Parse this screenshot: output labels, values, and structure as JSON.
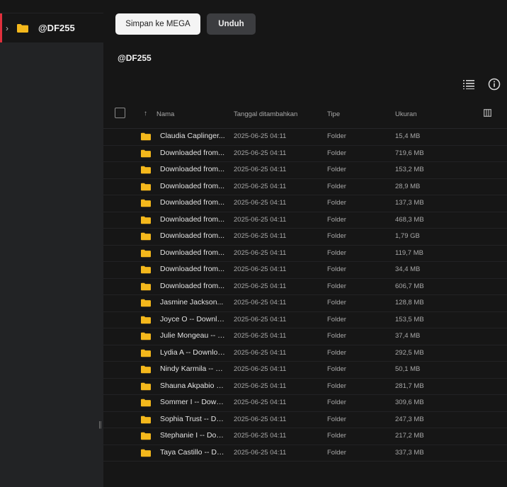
{
  "sidebar": {
    "items": [
      {
        "label": "@DF255"
      }
    ]
  },
  "toolbar": {
    "save_label": "Simpan ke MEGA",
    "download_label": "Unduh"
  },
  "path": {
    "title": "@DF255"
  },
  "colors": {
    "accent": "#e0303c",
    "folder": "#f4b81c"
  },
  "table": {
    "columns": {
      "name": "Nama",
      "date": "Tanggal ditambahkan",
      "type": "Tipe",
      "size": "Ukuran"
    },
    "rows": [
      {
        "name": "Claudia Caplinger...",
        "date": "2025-06-25 04:11",
        "type": "Folder",
        "size": "15,4 MB"
      },
      {
        "name": "Downloaded from...",
        "date": "2025-06-25 04:11",
        "type": "Folder",
        "size": "719,6 MB"
      },
      {
        "name": "Downloaded from...",
        "date": "2025-06-25 04:11",
        "type": "Folder",
        "size": "153,2 MB"
      },
      {
        "name": "Downloaded from...",
        "date": "2025-06-25 04:11",
        "type": "Folder",
        "size": "28,9 MB"
      },
      {
        "name": "Downloaded from...",
        "date": "2025-06-25 04:11",
        "type": "Folder",
        "size": "137,3 MB"
      },
      {
        "name": "Downloaded from...",
        "date": "2025-06-25 04:11",
        "type": "Folder",
        "size": "468,3 MB"
      },
      {
        "name": "Downloaded from...",
        "date": "2025-06-25 04:11",
        "type": "Folder",
        "size": "1,79 GB"
      },
      {
        "name": "Downloaded from...",
        "date": "2025-06-25 04:11",
        "type": "Folder",
        "size": "119,7 MB"
      },
      {
        "name": "Downloaded from...",
        "date": "2025-06-25 04:11",
        "type": "Folder",
        "size": "34,4 MB"
      },
      {
        "name": "Downloaded from...",
        "date": "2025-06-25 04:11",
        "type": "Folder",
        "size": "606,7 MB"
      },
      {
        "name": "Jasmine Jackson...",
        "date": "2025-06-25 04:11",
        "type": "Folder",
        "size": "128,8 MB"
      },
      {
        "name": "Joyce O -- Downloaded",
        "date": "2025-06-25 04:11",
        "type": "Folder",
        "size": "153,5 MB"
      },
      {
        "name": "Julie Mongeau -- Downloaded",
        "date": "2025-06-25 04:11",
        "type": "Folder",
        "size": "37,4 MB"
      },
      {
        "name": "Lydia A -- Downloaded",
        "date": "2025-06-25 04:11",
        "type": "Folder",
        "size": "292,5 MB"
      },
      {
        "name": "Nindy Karmila -- Downloaded",
        "date": "2025-06-25 04:11",
        "type": "Folder",
        "size": "50,1 MB"
      },
      {
        "name": "Shauna Akpabio -- Downloaded",
        "date": "2025-06-25 04:11",
        "type": "Folder",
        "size": "281,7 MB"
      },
      {
        "name": "Sommer I -- Downloaded",
        "date": "2025-06-25 04:11",
        "type": "Folder",
        "size": "309,6 MB"
      },
      {
        "name": "Sophia Trust -- Downloaded",
        "date": "2025-06-25 04:11",
        "type": "Folder",
        "size": "247,3 MB"
      },
      {
        "name": "Stephanie I -- Downloaded",
        "date": "2025-06-25 04:11",
        "type": "Folder",
        "size": "217,2 MB"
      },
      {
        "name": "Taya Castillo -- Downloaded",
        "date": "2025-06-25 04:11",
        "type": "Folder",
        "size": "337,3 MB"
      }
    ]
  }
}
